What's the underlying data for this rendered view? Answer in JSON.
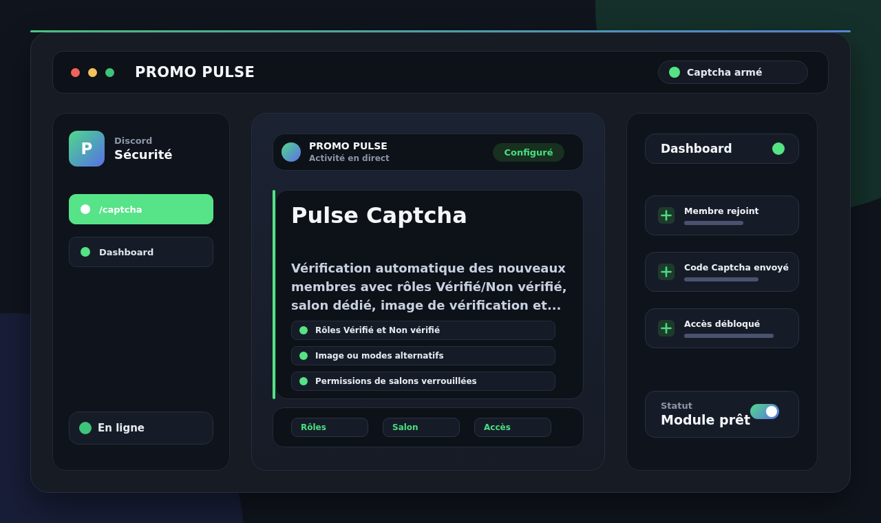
{
  "window": {
    "title": "PROMO PULSE",
    "controls": [
      {
        "color": "#f0625a"
      },
      {
        "color": "#f4c15d"
      },
      {
        "color": "#3ec47a"
      }
    ],
    "status": "Captcha armé"
  },
  "sidebar": {
    "logo": "P",
    "caption": "Discord",
    "title": "Sécurité",
    "items": [
      {
        "label": "/captcha",
        "selected": true
      },
      {
        "label": "Dashboard",
        "selected": false
      }
    ],
    "status": "En ligne"
  },
  "header": {
    "title": "PROMO PULSE",
    "subtitle": "Activité en direct",
    "badge": "Configuré"
  },
  "module": {
    "title": "Pulse Captcha",
    "description": "Vérification automatique des nouveaux membres avec rôles Vérifié/Non vérifié, salon dédié, image de vérification et...",
    "features": [
      "Rôles Vérifié et Non vérifié",
      "Image ou modes alternatifs",
      "Permissions de salons verrouillées"
    ],
    "shortcuts": [
      "Rôles",
      "Salon",
      "Accès"
    ]
  },
  "activity": {
    "title": "Dashboard",
    "events": [
      "Membre rejoint",
      "Code Captcha envoyé",
      "Accès débloqué"
    ],
    "status": {
      "caption": "Statut",
      "label": "Module prêt",
      "on": true
    }
  }
}
